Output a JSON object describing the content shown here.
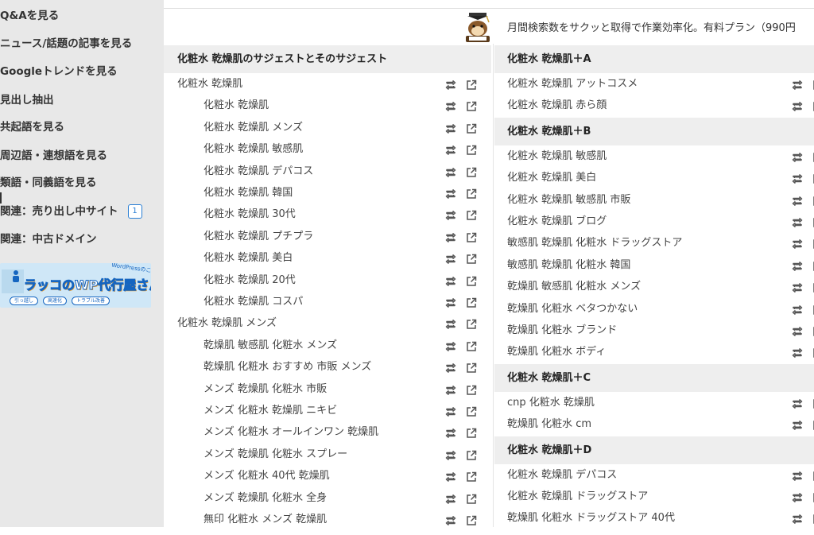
{
  "sidebar": {
    "items": [
      {
        "label": "Q&Aを見る"
      },
      {
        "label": "ニュース/話題の記事を見る"
      },
      {
        "label": "Googleトレンドを見る"
      },
      {
        "label": "見出し抽出"
      },
      {
        "label": "共起語を見る"
      },
      {
        "label": "周辺語・連想語を見る"
      },
      {
        "label": "類語・同義語を見る"
      },
      {
        "label": "関連：売り出し中サイト",
        "badge": "1"
      },
      {
        "label": "関連：中古ドメイン"
      }
    ],
    "banner": {
      "title": "ラッコのWP代行屋さん",
      "subtitle": "WordPressのことなら！",
      "tags": [
        "引っ越し",
        "高速化",
        "トラブル改善"
      ]
    }
  },
  "promo": {
    "text": "月間検索数をサクッと取得で作業効率化。有料プラン（990円"
  },
  "left_column": {
    "header": "化粧水 乾燥肌のサジェストとそのサジェスト",
    "rows": [
      {
        "text": "化粧水 乾燥肌",
        "level": 0
      },
      {
        "text": "化粧水 乾燥肌",
        "level": 1
      },
      {
        "text": "化粧水 乾燥肌 メンズ",
        "level": 1
      },
      {
        "text": "化粧水 乾燥肌 敏感肌",
        "level": 1
      },
      {
        "text": "化粧水 乾燥肌 デパコス",
        "level": 1
      },
      {
        "text": "化粧水 乾燥肌 韓国",
        "level": 1
      },
      {
        "text": "化粧水 乾燥肌 30代",
        "level": 1
      },
      {
        "text": "化粧水 乾燥肌 プチプラ",
        "level": 1
      },
      {
        "text": "化粧水 乾燥肌 美白",
        "level": 1
      },
      {
        "text": "化粧水 乾燥肌 20代",
        "level": 1
      },
      {
        "text": "化粧水 乾燥肌 コスパ",
        "level": 1
      },
      {
        "text": "化粧水 乾燥肌 メンズ",
        "level": 0
      },
      {
        "text": "乾燥肌 敏感肌 化粧水 メンズ",
        "level": 1
      },
      {
        "text": "乾燥肌 化粧水 おすすめ 市販 メンズ",
        "level": 1
      },
      {
        "text": "メンズ 乾燥肌 化粧水 市販",
        "level": 1
      },
      {
        "text": "メンズ 化粧水 乾燥肌 ニキビ",
        "level": 1
      },
      {
        "text": "メンズ 化粧水 オールインワン 乾燥肌",
        "level": 1
      },
      {
        "text": "メンズ 乾燥肌 化粧水 スプレー",
        "level": 1
      },
      {
        "text": "メンズ 化粧水 40代 乾燥肌",
        "level": 1
      },
      {
        "text": "メンズ 乾燥肌 化粧水 全身",
        "level": 1
      },
      {
        "text": "無印 化粧水 メンズ 乾燥肌",
        "level": 1
      }
    ]
  },
  "right_column": {
    "groups": [
      {
        "header": "化粧水 乾燥肌＋A",
        "rows": [
          "化粧水 乾燥肌 アットコスメ",
          "化粧水 乾燥肌 赤ら顔"
        ]
      },
      {
        "header": "化粧水 乾燥肌＋B",
        "rows": [
          "化粧水 乾燥肌 敏感肌",
          "化粧水 乾燥肌 美白",
          "化粧水 乾燥肌 敏感肌 市販",
          "化粧水 乾燥肌 ブログ",
          "敏感肌 乾燥肌 化粧水 ドラッグストア",
          "敏感肌 乾燥肌 化粧水 韓国",
          "乾燥肌 敏感肌 化粧水 メンズ",
          "乾燥肌 化粧水 ベタつかない",
          "乾燥肌 化粧水 ブランド",
          "乾燥肌 化粧水 ボディ"
        ]
      },
      {
        "header": "化粧水 乾燥肌＋C",
        "rows": [
          "cnp 化粧水 乾燥肌",
          "乾燥肌 化粧水 cm"
        ]
      },
      {
        "header": "化粧水 乾燥肌＋D",
        "rows": [
          "化粧水 乾燥肌 デパコス",
          "化粧水 乾燥肌 ドラッグストア",
          "乾燥肌 化粧水 ドラッグストア 40代"
        ]
      }
    ]
  },
  "icons": {
    "expand": "retweet-icon",
    "open": "external-link-icon"
  },
  "colors": {
    "sidebar_bg": "#e8e8e8",
    "header_bg": "#eeeeee",
    "icon": "#555555",
    "badge": "#2a7fd4"
  }
}
